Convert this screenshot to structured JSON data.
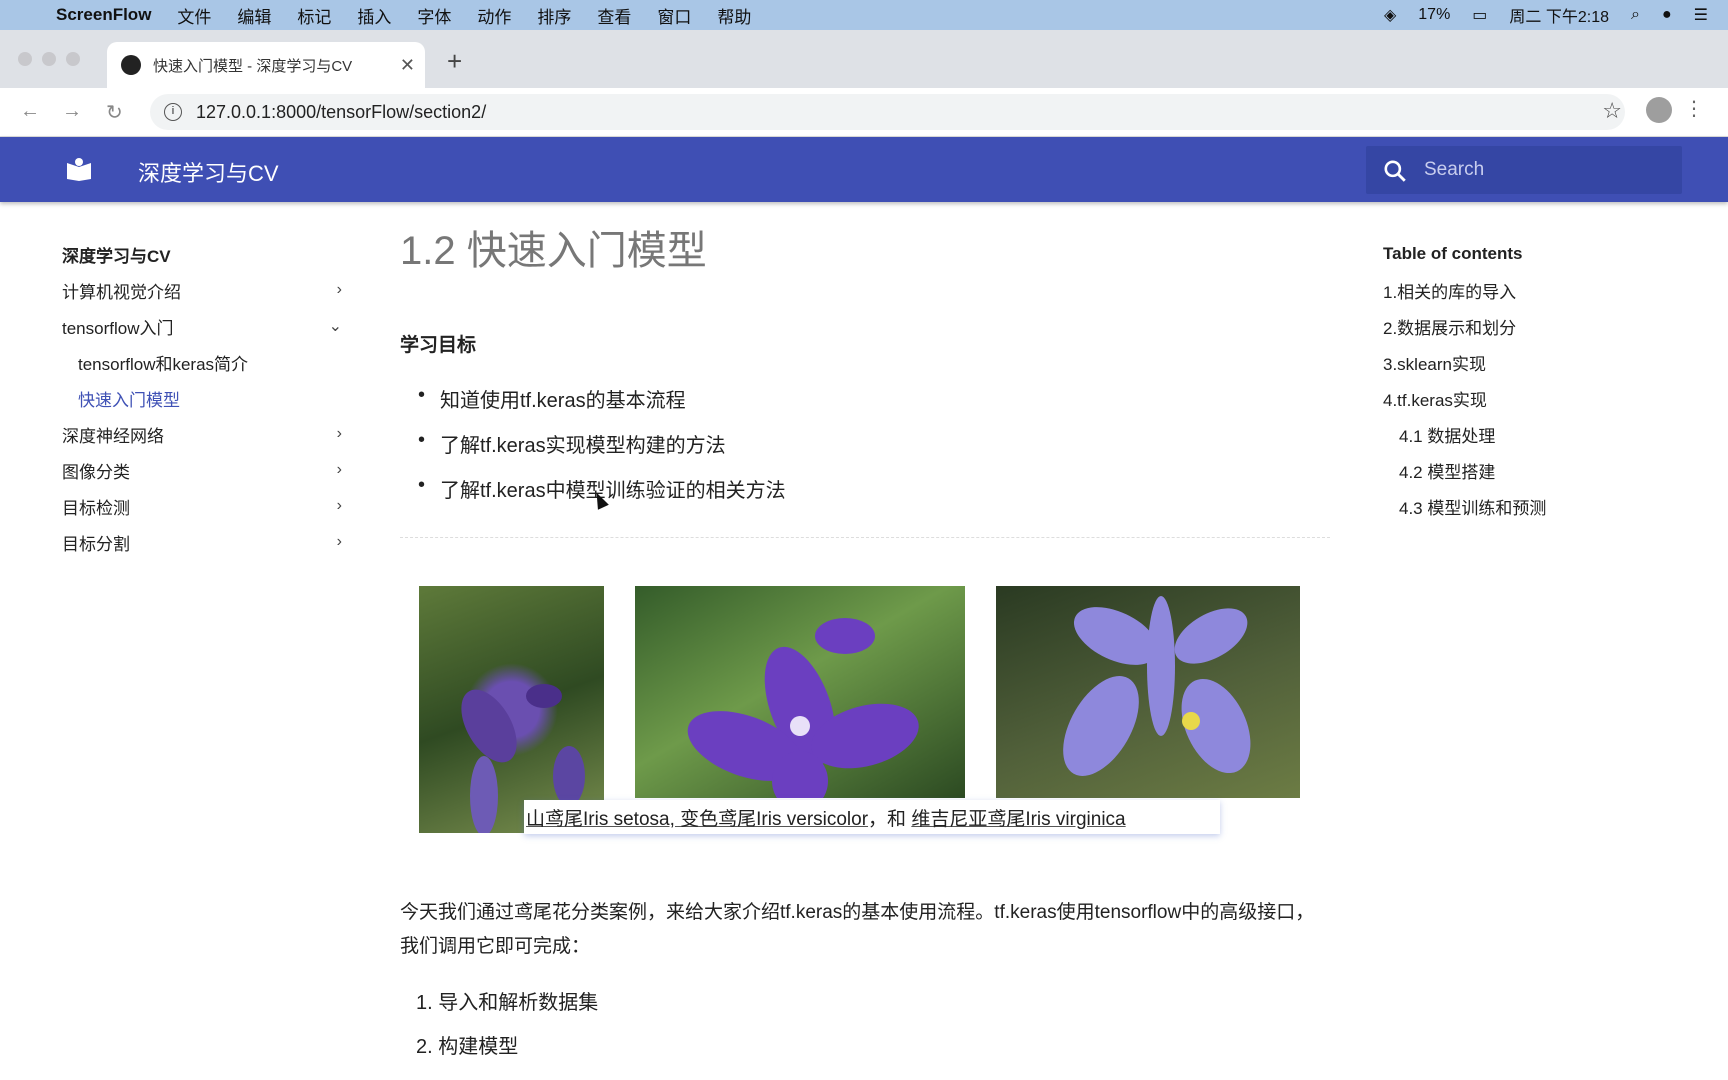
{
  "menubar": {
    "app": "ScreenFlow",
    "items": [
      "文件",
      "编辑",
      "标记",
      "插入",
      "字体",
      "动作",
      "排序",
      "查看",
      "窗口",
      "帮助"
    ],
    "battery": "17%",
    "clock": "周二 下午2:18"
  },
  "browser": {
    "tab_title": "快速入门模型 - 深度学习与CV",
    "url": "127.0.0.1:8000/tensorFlow/section2/"
  },
  "header": {
    "site_name": "深度学习与CV",
    "search_placeholder": "Search",
    "color": "#3f4fb4"
  },
  "sidebar": {
    "title": "深度学习与CV",
    "items": [
      {
        "label": "计算机视觉介绍",
        "chevron": "›"
      },
      {
        "label": "tensorflow入门",
        "chevron": "⌄"
      },
      {
        "label": "tensorflow和keras简介",
        "sub": true
      },
      {
        "label": "快速入门模型",
        "sub": true,
        "active": true
      },
      {
        "label": "深度神经网络",
        "chevron": "›"
      },
      {
        "label": "图像分类",
        "chevron": "›"
      },
      {
        "label": "目标检测",
        "chevron": "›"
      },
      {
        "label": "目标分割",
        "chevron": "›"
      }
    ]
  },
  "content": {
    "title": "1.2 快速入门模型",
    "goal_heading": "学习目标",
    "goals": [
      "知道使用tf.keras的基本流程",
      "了解tf.keras实现模型构建的方法",
      "了解tf.keras中模型训练验证的相关方法"
    ],
    "caption": {
      "a": "山鸢尾Iris setosa, 变色鸢尾Iris versicolor",
      "sep": "，和 ",
      "b": "维吉尼亚鸢尾Iris virginica"
    },
    "paragraph": "今天我们通过鸢尾花分类案例，来给大家介绍tf.keras的基本使用流程。tf.keras使用tensorflow中的高级接口，我们调用它即可完成：",
    "steps": [
      "1. 导入和解析数据集",
      "2. 构建模型"
    ]
  },
  "toc": {
    "title": "Table of contents",
    "items": [
      {
        "label": "1.相关的库的导入"
      },
      {
        "label": "2.数据展示和划分"
      },
      {
        "label": "3.sklearn实现"
      },
      {
        "label": "4.tf.keras实现"
      },
      {
        "label": "4.1 数据处理",
        "sub": true
      },
      {
        "label": "4.2 模型搭建",
        "sub": true
      },
      {
        "label": "4.3 模型训练和预测",
        "sub": true
      }
    ]
  }
}
